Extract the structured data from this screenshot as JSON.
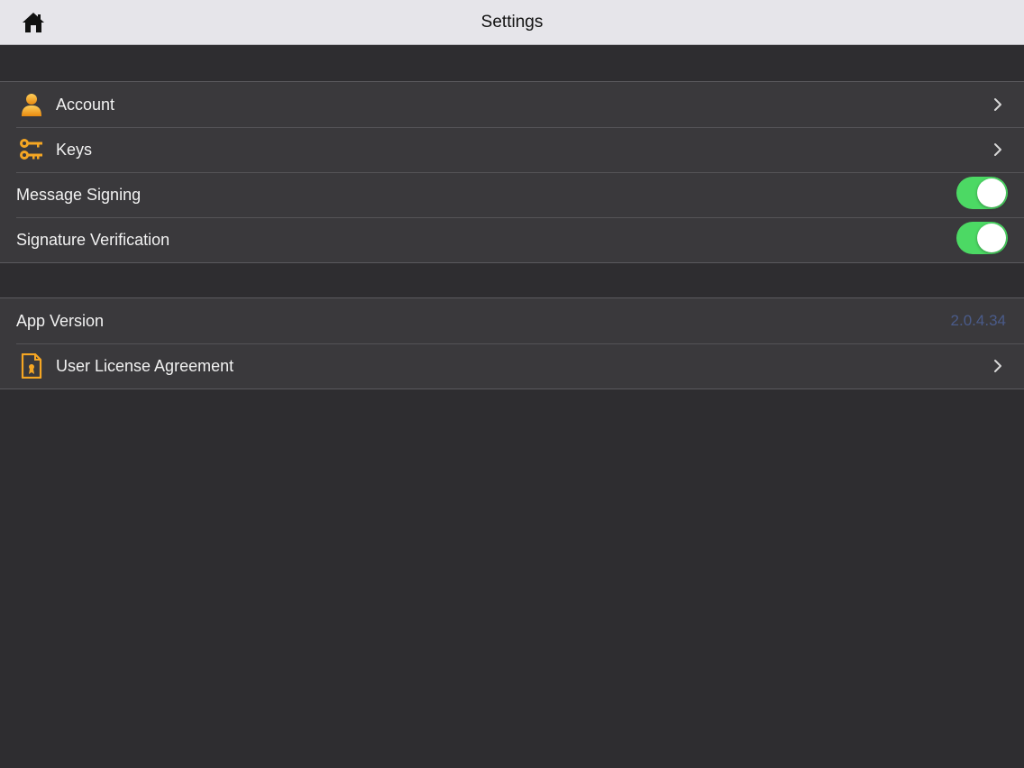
{
  "nav": {
    "title": "Settings",
    "home_icon": "home-icon"
  },
  "section1": {
    "account": {
      "label": "Account",
      "icon": "person-icon"
    },
    "keys": {
      "label": "Keys",
      "icon": "keys-icon"
    },
    "message_signing": {
      "label": "Message Signing",
      "enabled": true
    },
    "signature_verification": {
      "label": "Signature Verification",
      "enabled": true
    }
  },
  "section2": {
    "app_version": {
      "label": "App Version",
      "value": "2.0.4.34"
    },
    "license": {
      "label": "User License Agreement",
      "icon": "document-icon"
    }
  },
  "colors": {
    "accent_icon": "#f5a623",
    "toggle_on": "#4cd964",
    "version_text": "#4a5b8a",
    "background": "#2e2d30"
  }
}
